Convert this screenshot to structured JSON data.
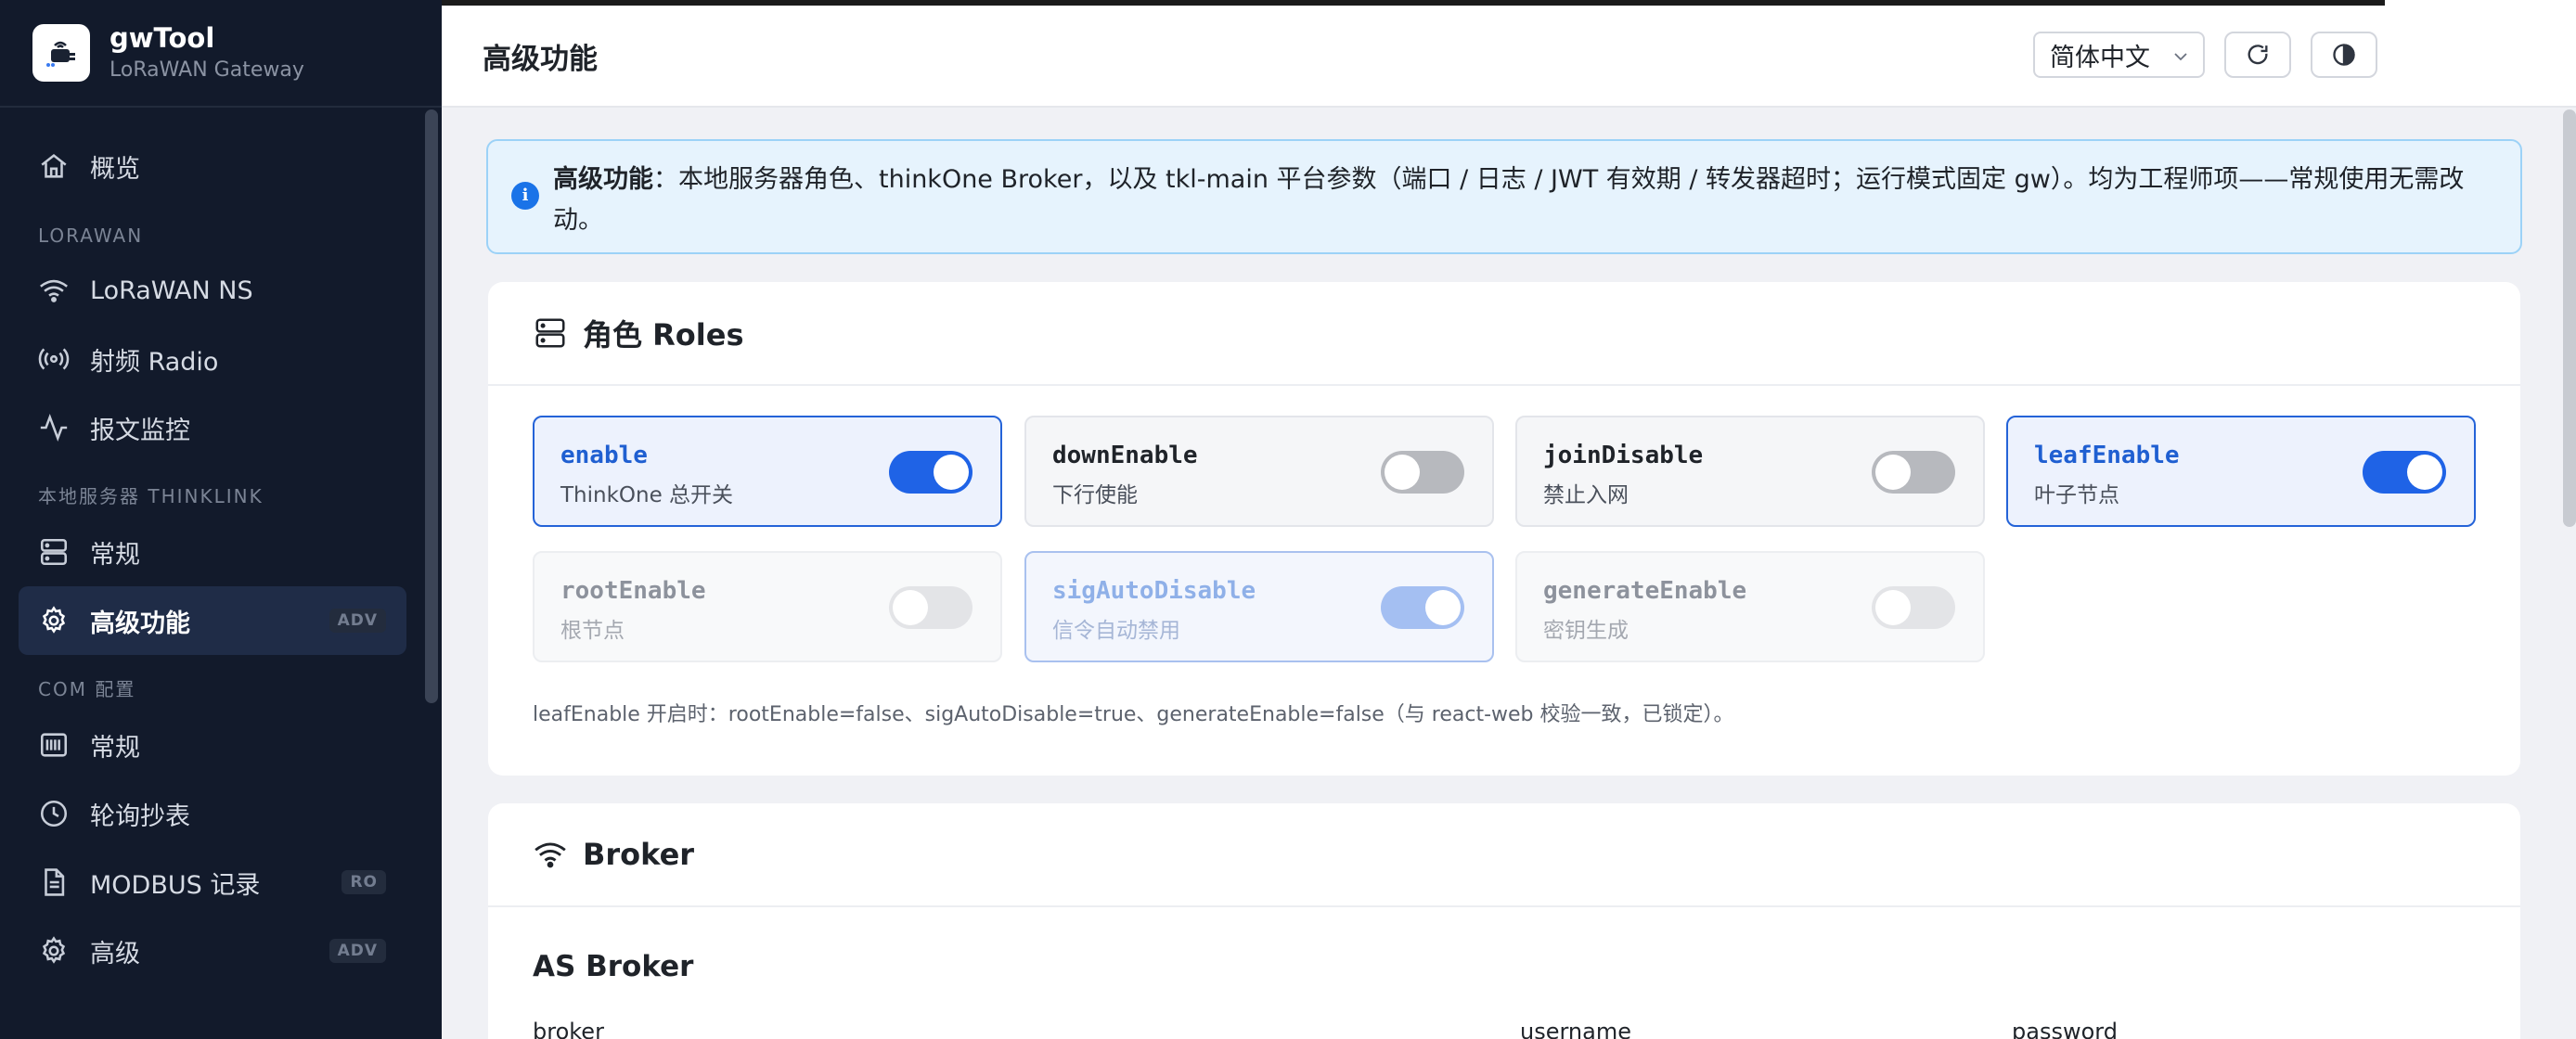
{
  "brand": {
    "name": "gwTool",
    "subtitle": "LoRaWAN Gateway"
  },
  "sidebar": {
    "items": [
      {
        "label": "概览",
        "icon": "home-icon"
      },
      {
        "section": "LORAWAN"
      },
      {
        "label": "LoRaWAN NS",
        "icon": "wifi-icon"
      },
      {
        "label": "射频 Radio",
        "icon": "radio-icon"
      },
      {
        "label": "报文监控",
        "icon": "activity-icon"
      },
      {
        "section": "本地服务器 THINKLINK"
      },
      {
        "label": "常规",
        "icon": "server-icon"
      },
      {
        "label": "高级功能",
        "icon": "gear-icon",
        "badge": "ADV",
        "active": true
      },
      {
        "section": "COM 配置"
      },
      {
        "label": "常规",
        "icon": "barcode-icon"
      },
      {
        "label": "轮询抄表",
        "icon": "clock-icon"
      },
      {
        "label": "MODBUS 记录",
        "icon": "file-icon",
        "badge": "RO"
      },
      {
        "label": "高级",
        "icon": "gear-icon",
        "badge": "ADV"
      }
    ]
  },
  "header": {
    "title": "高级功能",
    "language": "简体中文"
  },
  "alert": {
    "strong": "高级功能",
    "text": "：本地服务器角色、thinkOne Broker，以及 tkl-main 平台参数（端口 / 日志 / JWT 有效期 / 转发器超时；运行模式固定 gw）。均为工程师项——常规使用无需改动。"
  },
  "roles_card": {
    "title": "角色 Roles",
    "roles": [
      {
        "key": "enable",
        "desc": "ThinkOne 总开关",
        "on": true,
        "disabled": false
      },
      {
        "key": "downEnable",
        "desc": "下行使能",
        "on": false,
        "disabled": false
      },
      {
        "key": "joinDisable",
        "desc": "禁止入网",
        "on": false,
        "disabled": false
      },
      {
        "key": "leafEnable",
        "desc": "叶子节点",
        "on": true,
        "disabled": false
      },
      {
        "key": "rootEnable",
        "desc": "根节点",
        "on": false,
        "disabled": true
      },
      {
        "key": "sigAutoDisable",
        "desc": "信令自动禁用",
        "on": true,
        "disabled": true
      },
      {
        "key": "generateEnable",
        "desc": "密钥生成",
        "on": false,
        "disabled": true
      }
    ],
    "note": "leafEnable 开启时：rootEnable=false、sigAutoDisable=true、generateEnable=false（与 react-web 校验一致，已锁定）。"
  },
  "broker_card": {
    "title": "Broker",
    "section_title": "AS Broker",
    "fields": {
      "broker": "broker",
      "username": "username",
      "password": "password"
    }
  }
}
